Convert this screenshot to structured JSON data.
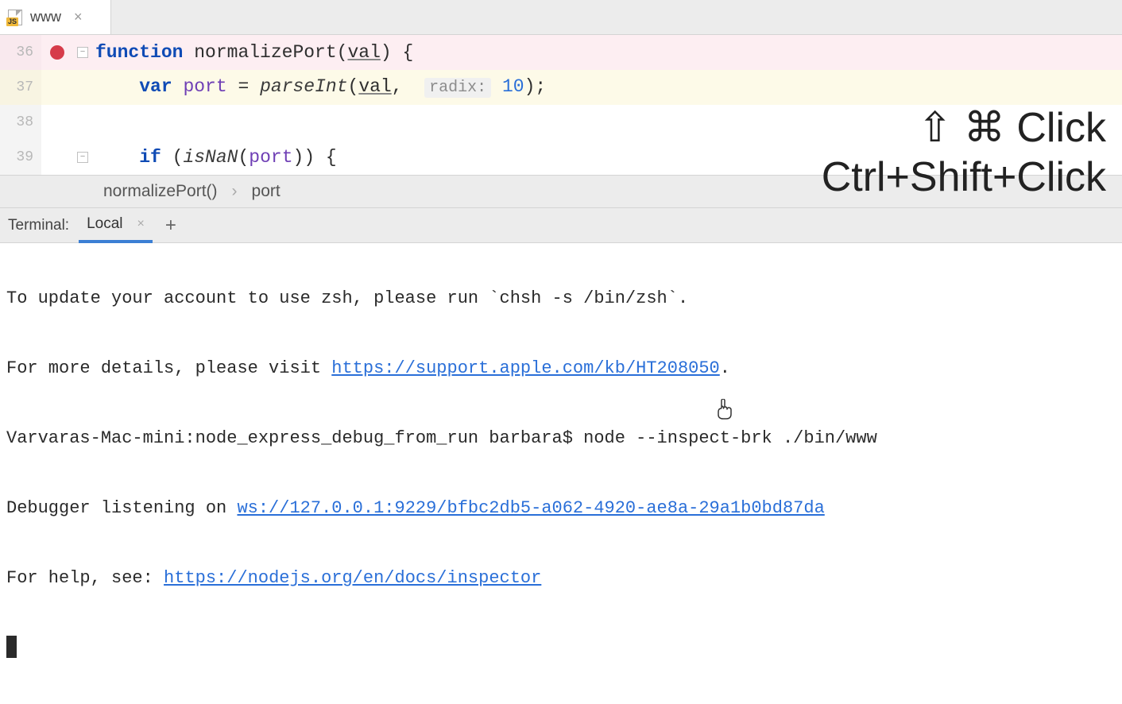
{
  "tab": {
    "icon_badge": "JS",
    "filename": "www",
    "close": "×"
  },
  "code": {
    "lines": [
      {
        "num": "36",
        "bp": true,
        "fold": true
      },
      {
        "num": "37",
        "bp": false,
        "fold": false
      },
      {
        "num": "38",
        "bp": false,
        "fold": false
      },
      {
        "num": "39",
        "bp": false,
        "fold": true
      }
    ],
    "kw_function": "function",
    "fn_name": "normalizePort",
    "param_val": "val",
    "brace_open": " {",
    "kw_var": "var",
    "ident_port": "port",
    "eq": " = ",
    "parseInt": "parseInt",
    "hint_radix": "radix:",
    "num_10": "10",
    "kw_if": "if",
    "isNaN": "isNaN",
    "close_paren_semi": ");",
    "close_paren": ")",
    "open_paren": "(",
    "comma_sp": ", "
  },
  "breadcrumb": {
    "item1": "normalizePort()",
    "sep": "›",
    "item2": "port"
  },
  "terminal_header": {
    "label": "Terminal:",
    "tab": "Local",
    "close": "×",
    "add": "+"
  },
  "terminal": {
    "line1_a": "To update your account to use zsh, please run `chsh -s /bin/zsh`.",
    "line2_a": "For more details, please visit ",
    "line2_link": "https://support.apple.com/kb/HT208050",
    "line2_b": ".",
    "line3": "Varvaras-Mac-mini:node_express_debug_from_run barbara$ node --inspect-brk ./bin/www",
    "line4_a": "Debugger listening on ",
    "line4_link": "ws://127.0.0.1:9229/bfbc2db5-a062-4920-ae8a-29a1b0bd87da",
    "line5_a": "For help, see: ",
    "line5_link": "https://nodejs.org/en/docs/inspector"
  },
  "overlay": {
    "line1": "⇧ ⌘ Click",
    "line2": "Ctrl+Shift+Click"
  }
}
